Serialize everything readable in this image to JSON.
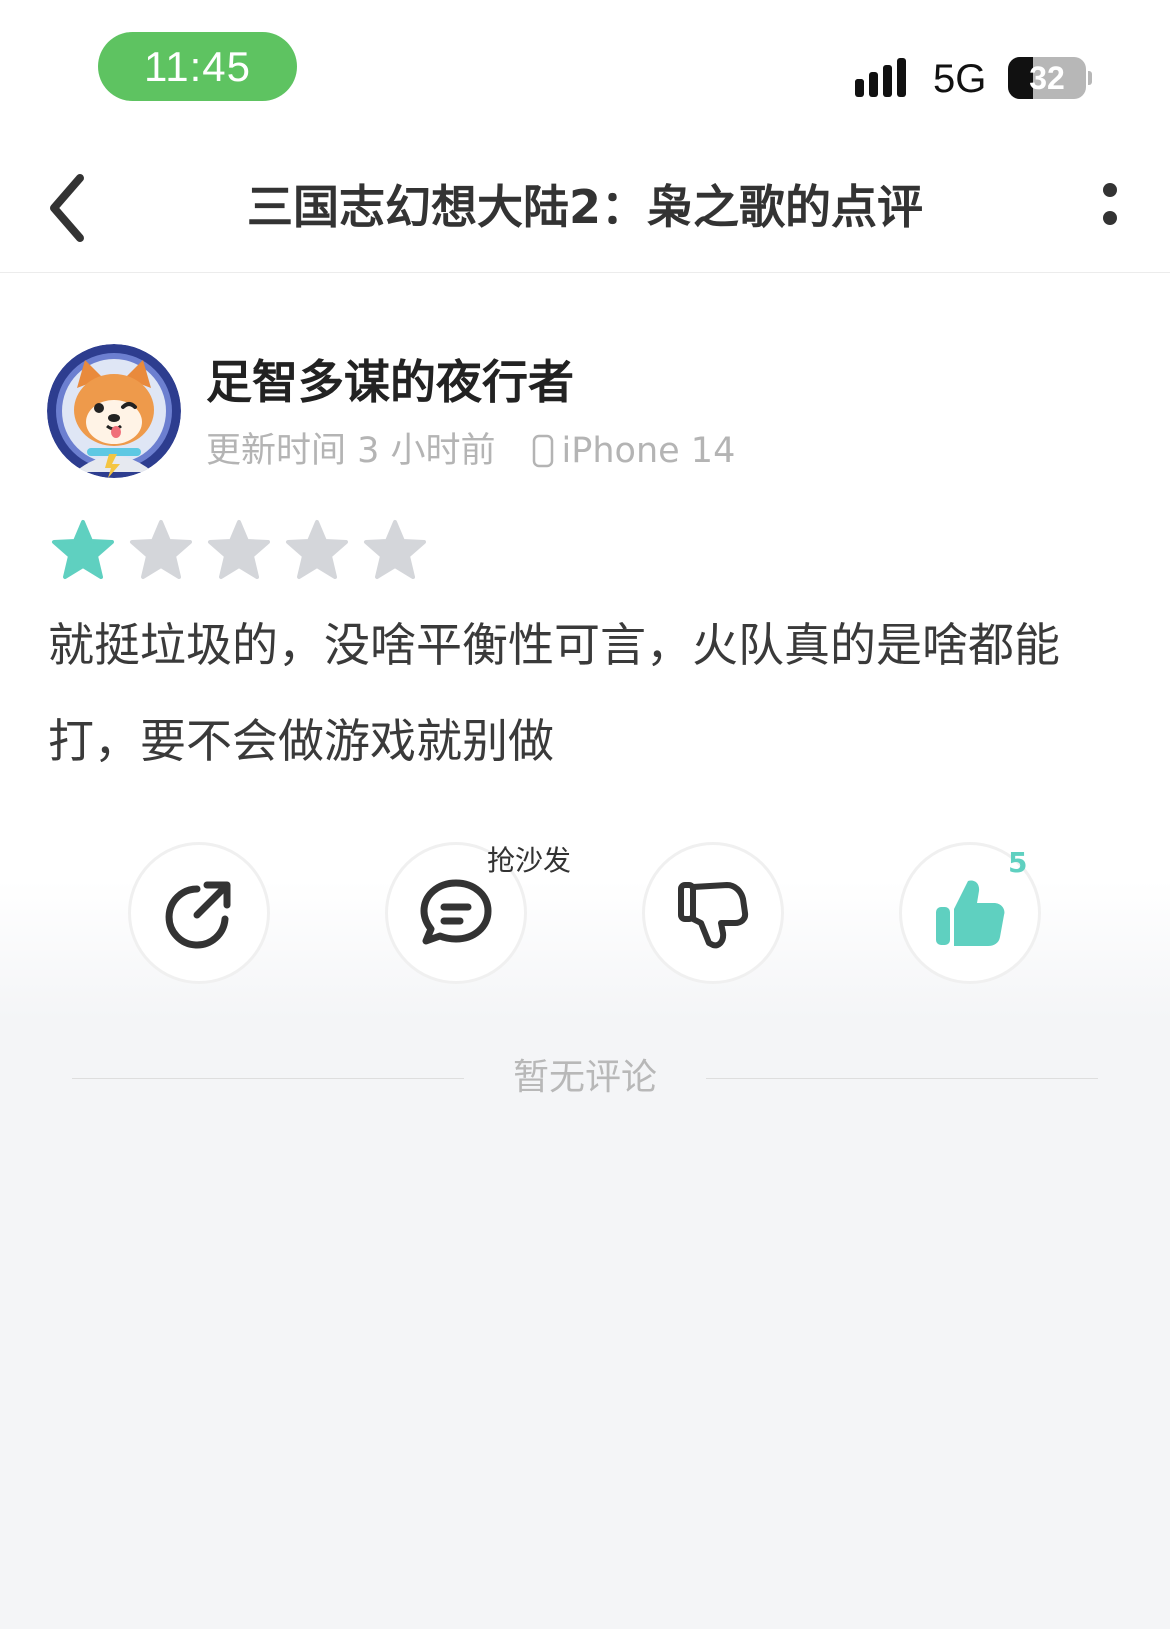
{
  "status_bar": {
    "time": "11:45",
    "network": "5G",
    "battery_level": "32",
    "battery_fraction": 0.32,
    "time_pill_color": "#5ec361"
  },
  "nav": {
    "back_icon": "chevron-left-icon",
    "title": "三国志幻想大陆2：枭之歌的点评",
    "more_icon": "more-vertical-icon"
  },
  "review": {
    "author_name": "足智多谋的夜行者",
    "update_time": "更新时间 3 小时前",
    "device": "iPhone 14",
    "device_icon": "phone-icon",
    "rating": 1,
    "rating_max": 5,
    "text": "就挺垃圾的，没啥平衡性可言，火队真的是啥都能打，要不会做游戏就别做"
  },
  "actions": {
    "share_icon": "share-icon",
    "comment_icon": "comment-icon",
    "comment_label": "抢沙发",
    "dislike_icon": "thumbs-down-icon",
    "like_icon": "thumbs-up-icon",
    "like_count": "5"
  },
  "comments": {
    "empty_text": "暂无评论"
  },
  "colors": {
    "accent": "#5fd0c0",
    "star_empty": "#d4d6da",
    "icon_dark": "#333333"
  }
}
